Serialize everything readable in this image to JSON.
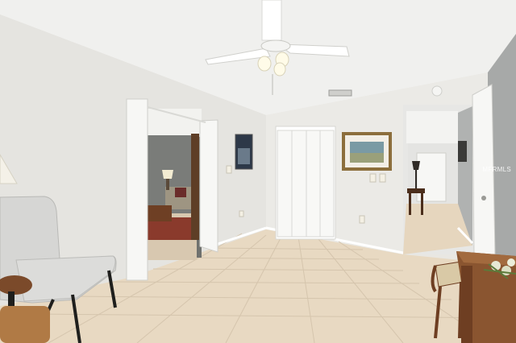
{
  "scene": {
    "description_hidden": "",
    "colors": {
      "ceiling": "#f0f0ee",
      "wall_left": "#e6e5e1",
      "wall_back": "#eceae6",
      "wall_right": "#a9abaa",
      "floor": "#e9dac3",
      "floor_grout": "#d6c6ae",
      "door_white": "#f7f7f5",
      "wood": "#7a4a2a",
      "chair_grey": "#d4d4d2",
      "living_room_wall": "#7d7f7c",
      "rug": "#8a3a2c"
    }
  },
  "watermark": {
    "text": "MFRMLS"
  }
}
